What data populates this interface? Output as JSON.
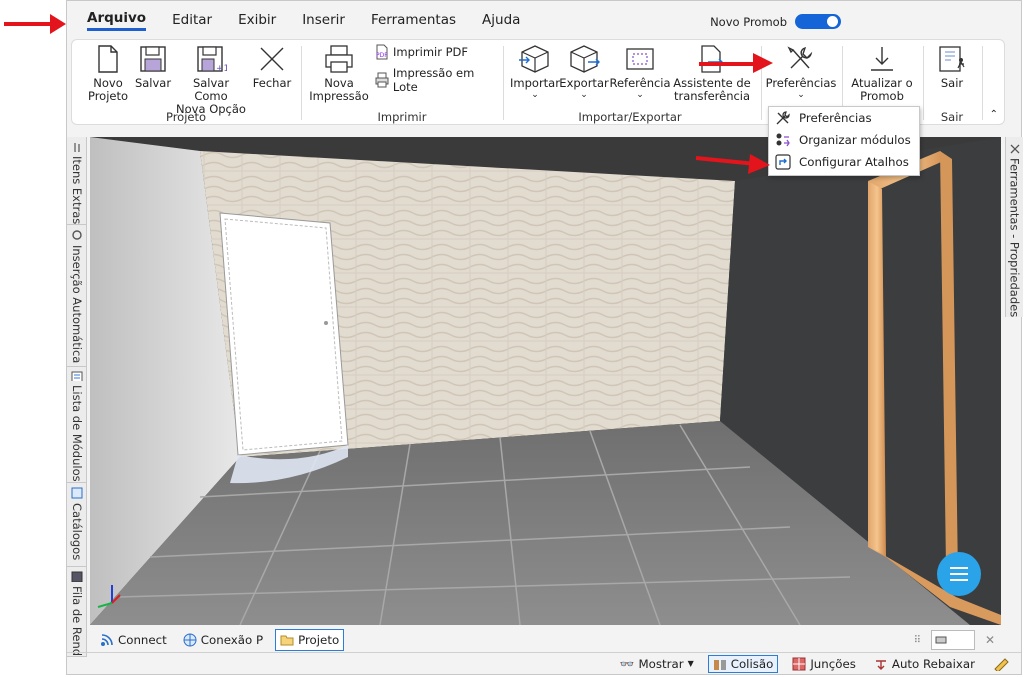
{
  "menu": {
    "items": [
      "Arquivo",
      "Editar",
      "Exibir",
      "Inserir",
      "Ferramentas",
      "Ajuda"
    ],
    "active": "Arquivo",
    "toggle_label": "Novo Promob"
  },
  "ribbon": {
    "projeto": {
      "title": "Projeto",
      "novo_projeto": [
        "Novo",
        "Projeto"
      ],
      "salvar": "Salvar",
      "salvar_como": [
        "Salvar Como",
        "Nova Opção"
      ],
      "fechar": "Fechar"
    },
    "imprimir": {
      "title": "Imprimir",
      "nova_impressao": [
        "Nova",
        "Impressão"
      ],
      "imprimir_pdf": "Imprimir PDF",
      "impressao_lote": "Impressão em Lote"
    },
    "importar_exportar": {
      "title": "Importar/Exportar",
      "importar": "Importar",
      "exportar": "Exportar",
      "referencia": "Referência",
      "assistente": [
        "Assistente de",
        "transferência"
      ]
    },
    "preferencias": {
      "label": "Preferências"
    },
    "atualizar": [
      "Atualizar o",
      "Promob"
    ],
    "sair": {
      "title": "Sair",
      "label": "Sair"
    }
  },
  "dropdown": {
    "items": [
      "Preferências",
      "Organizar módulos",
      "Configurar Atalhos"
    ]
  },
  "left_tabs": [
    "Itens Extras",
    "Inserção Automática",
    "Lista de Módulos",
    "Catálogos",
    "Fila de Rend"
  ],
  "right_tabs": [
    "Ferramentas - Propriedades"
  ],
  "bottom_tabs": [
    "Connect",
    "Conexão P",
    "Projeto"
  ],
  "status": {
    "mostrar": "Mostrar",
    "colisao": "Colisão",
    "juncoes": "Junções",
    "auto_rebaixar": "Auto Rebaixar"
  },
  "colors": {
    "accent": "#1565d8",
    "arrow": "#e3141b"
  }
}
